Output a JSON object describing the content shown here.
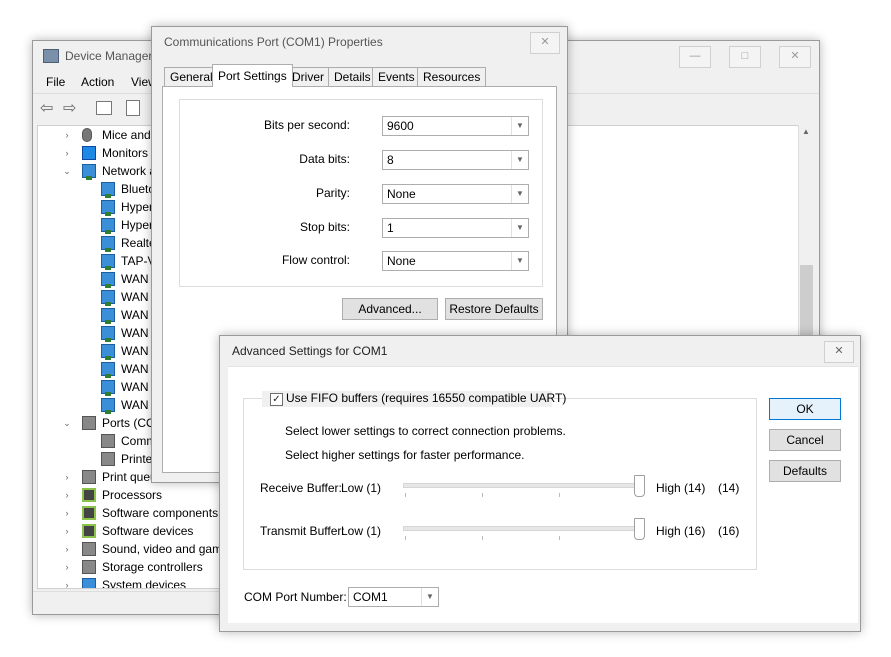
{
  "device_manager": {
    "title": "Device Manager",
    "menu": [
      "File",
      "Action",
      "View"
    ],
    "tree": [
      {
        "label": "Mice and",
        "indent": 0,
        "arrow": "›",
        "icon": "mouse"
      },
      {
        "label": "Monitors",
        "indent": 0,
        "arrow": "›",
        "icon": "monitor"
      },
      {
        "label": "Network a",
        "indent": 0,
        "arrow": "⌄",
        "icon": "network"
      },
      {
        "label": "Blueto",
        "indent": 1,
        "icon": "network"
      },
      {
        "label": "Hyper",
        "indent": 1,
        "icon": "network"
      },
      {
        "label": "Hyper",
        "indent": 1,
        "icon": "network"
      },
      {
        "label": "Realte",
        "indent": 1,
        "icon": "network"
      },
      {
        "label": "TAP-V",
        "indent": 1,
        "icon": "network"
      },
      {
        "label": "WAN",
        "indent": 1,
        "icon": "network"
      },
      {
        "label": "WAN",
        "indent": 1,
        "icon": "network"
      },
      {
        "label": "WAN",
        "indent": 1,
        "icon": "network"
      },
      {
        "label": "WAN",
        "indent": 1,
        "icon": "network"
      },
      {
        "label": "WAN",
        "indent": 1,
        "icon": "network"
      },
      {
        "label": "WAN",
        "indent": 1,
        "icon": "network"
      },
      {
        "label": "WAN",
        "indent": 1,
        "icon": "network"
      },
      {
        "label": "WAN",
        "indent": 1,
        "icon": "network"
      },
      {
        "label": "Ports (CO",
        "indent": 0,
        "arrow": "⌄",
        "icon": "port"
      },
      {
        "label": "Comm",
        "indent": 1,
        "icon": "port"
      },
      {
        "label": "Printe",
        "indent": 1,
        "icon": "port"
      },
      {
        "label": "Print queu",
        "indent": 0,
        "arrow": "›",
        "icon": "printer"
      },
      {
        "label": "Processors",
        "indent": 0,
        "arrow": "›",
        "icon": "chip"
      },
      {
        "label": "Software components",
        "indent": 0,
        "arrow": "›",
        "icon": "chip"
      },
      {
        "label": "Software devices",
        "indent": 0,
        "arrow": "›",
        "icon": "chip"
      },
      {
        "label": "Sound, video and gam",
        "indent": 0,
        "arrow": "›",
        "icon": "sound"
      },
      {
        "label": "Storage controllers",
        "indent": 0,
        "arrow": "›",
        "icon": "storage"
      },
      {
        "label": "System devices",
        "indent": 0,
        "arrow": "›",
        "icon": "system"
      }
    ]
  },
  "properties": {
    "title": "Communications Port (COM1) Properties",
    "tabs": [
      "General",
      "Port Settings",
      "Driver",
      "Details",
      "Events",
      "Resources"
    ],
    "active_tab": "Port Settings",
    "fields": [
      {
        "label": "Bits per second:",
        "value": "9600"
      },
      {
        "label": "Data bits:",
        "value": "8"
      },
      {
        "label": "Parity:",
        "value": "None"
      },
      {
        "label": "Stop bits:",
        "value": "1"
      },
      {
        "label": "Flow control:",
        "value": "None"
      }
    ],
    "advanced_button": "Advanced...",
    "restore_button": "Restore Defaults"
  },
  "advanced": {
    "title": "Advanced Settings for COM1",
    "fifo_label": "Use FIFO buffers (requires 16550 compatible UART)",
    "fifo_checked": true,
    "hint_lower": "Select lower settings to correct connection problems.",
    "hint_higher": "Select higher settings for faster performance.",
    "receive": {
      "label": "Receive Buffer:",
      "low": "Low (1)",
      "high": "High (14)",
      "value": "(14)",
      "level": 1.0
    },
    "transmit": {
      "label": "Transmit Buffer:",
      "low": "Low (1)",
      "high": "High (16)",
      "value": "(16)",
      "level": 1.0
    },
    "com_port_label": "COM Port Number:",
    "com_port_value": "COM1",
    "ok_button": "OK",
    "cancel_button": "Cancel",
    "defaults_button": "Defaults"
  }
}
